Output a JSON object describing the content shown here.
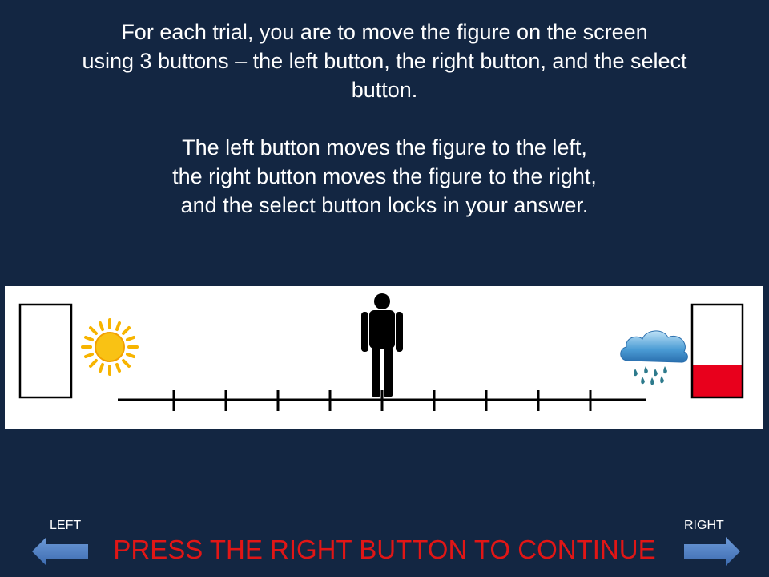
{
  "instructions": {
    "para1_line1": "For each trial, you are to move the figure on the screen",
    "para1_line2": "using 3 buttons – the left button, the right button, and the select",
    "para1_line3": "button.",
    "para2_line1": "The left button moves the figure to the left,",
    "para2_line2": "the right button moves the figure to the right,",
    "para2_line3": "and the select button locks in your answer."
  },
  "scale": {
    "left_icon": "sun-icon",
    "right_icon": "rain-cloud-icon",
    "figure_icon": "person-figure-icon",
    "tick_count": 9,
    "figure_position_tick": 5,
    "left_box_fill_fraction": 0,
    "right_box_fill_fraction": 0.35
  },
  "navigation": {
    "left_label": "LEFT",
    "right_label": "RIGHT",
    "continue_text": "PRESS THE RIGHT BUTTON TO CONTINUE"
  },
  "colors": {
    "background": "#132642",
    "prompt": "#e11616",
    "arrow": "#4f80c6",
    "fill_box": "#e8001c",
    "sun": "#f7b400"
  }
}
